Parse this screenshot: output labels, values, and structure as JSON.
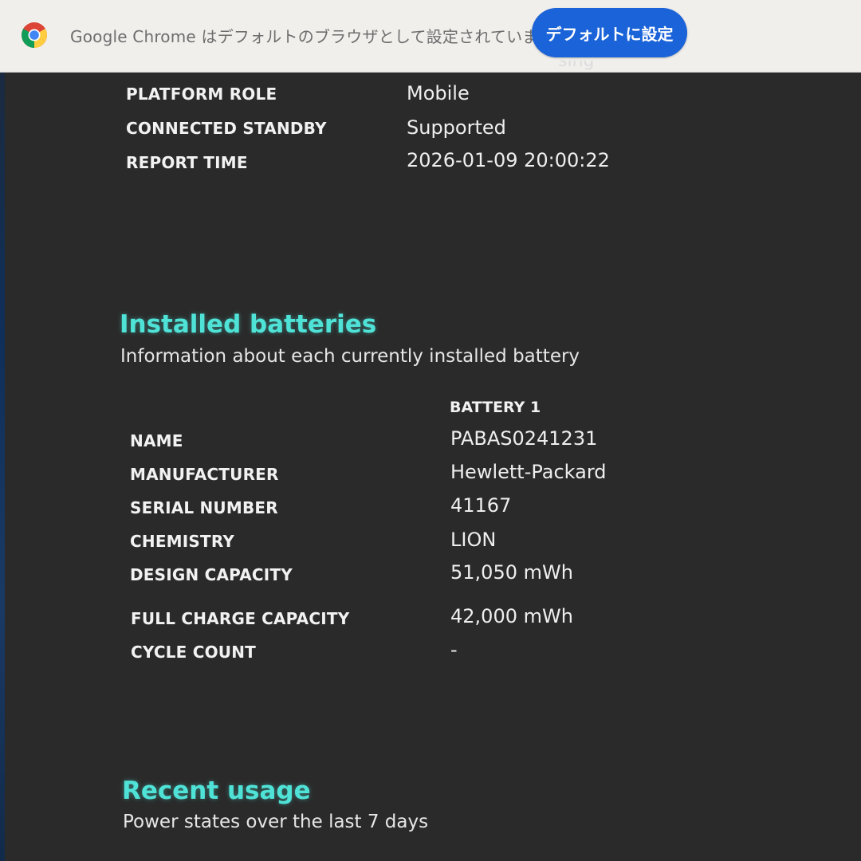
{
  "infobar": {
    "message": "Google Chrome はデフォルトのブラウザとして設定されていません",
    "button_label": "デフォルトに設定",
    "icon": "chrome-icon"
  },
  "clipped_text": "sing",
  "system_info": [
    {
      "label": "PLATFORM ROLE",
      "value": "Mobile"
    },
    {
      "label": "CONNECTED STANDBY",
      "value": "Supported"
    },
    {
      "label": "REPORT TIME",
      "value": "2026-01-09  20:00:22"
    }
  ],
  "installed_batteries": {
    "title": "Installed batteries",
    "subtitle": "Information about each currently installed battery",
    "column_header": "BATTERY 1",
    "rows": [
      {
        "label": "NAME",
        "value": "PABAS0241231"
      },
      {
        "label": "MANUFACTURER",
        "value": "Hewlett-Packard"
      },
      {
        "label": "SERIAL NUMBER",
        "value": "41167"
      },
      {
        "label": "CHEMISTRY",
        "value": "LION"
      },
      {
        "label": "DESIGN CAPACITY",
        "value": "51,050 mWh"
      },
      {
        "label": "FULL CHARGE CAPACITY",
        "value": "42,000 mWh"
      },
      {
        "label": "CYCLE COUNT",
        "value": "-"
      }
    ]
  },
  "recent_usage": {
    "title": "Recent usage",
    "subtitle": "Power states over the last 7 days"
  },
  "colors": {
    "background": "#2a2a2a",
    "heading": "#4fe3d8",
    "button": "#1a63d8",
    "infobar": "#f1efec"
  }
}
